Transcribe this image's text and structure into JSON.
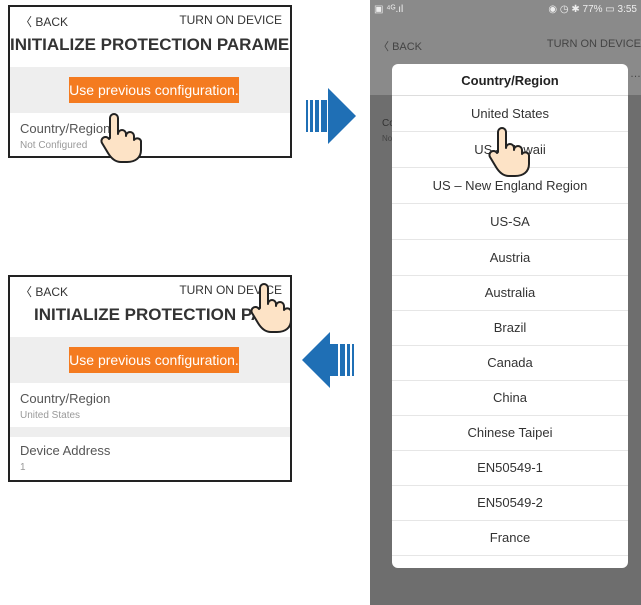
{
  "panel_before": {
    "back": "BACK",
    "turn_on": "TURN ON DEVICE",
    "title": "INITIALIZE PROTECTION PARAME…",
    "use_previous": "Use previous configuration.",
    "country_label": "Country/Region",
    "country_value": "Not Configured"
  },
  "panel_after": {
    "back": "BACK",
    "turn_on": "TURN ON DEVICE",
    "title": "INITIALIZE PROTECTION PARAM",
    "use_previous": "Use previous configuration.",
    "country_label": "Country/Region",
    "country_value": "United States",
    "device_label": "Device Address",
    "device_value": "1"
  },
  "phone": {
    "status_left": "▣ ⁴ᴳ.ıl",
    "status_right": "◉ ◷ ✱ 77% ▭ 3:55",
    "back": "BACK",
    "turn_on": "TURN ON DEVICE",
    "dots": "…",
    "bg_c": "Co",
    "bg_n": "No",
    "dialog_title": "Country/Region",
    "options": [
      "United States",
      "US – Hawaii",
      "US – New England Region",
      "US-SA",
      "Austria",
      "Australia",
      "Brazil",
      "Canada",
      "China",
      "Chinese Taipei",
      "EN50549-1",
      "EN50549-2",
      "France"
    ]
  },
  "colors": {
    "orange": "#f47b20",
    "arrow_blue": "#1f6fb5"
  }
}
